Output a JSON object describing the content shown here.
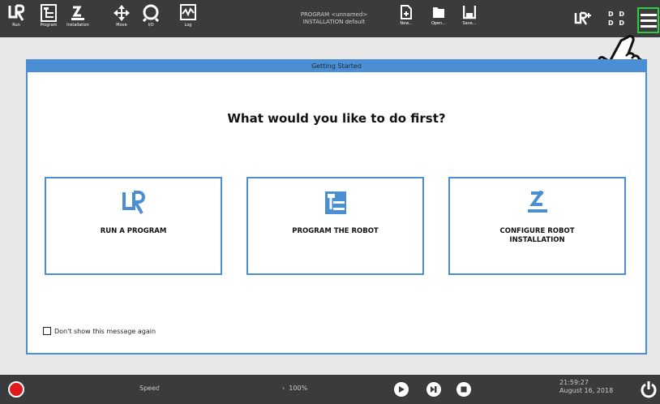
{
  "topbar": {
    "nav": [
      {
        "label": "Run",
        "icon": "ur-logo-icon"
      },
      {
        "label": "Program",
        "icon": "program-icon"
      },
      {
        "label": "Installation",
        "icon": "robot-arm-icon"
      },
      {
        "label": "Move",
        "icon": "move-arrows-icon"
      },
      {
        "label": "I/O",
        "icon": "io-icon"
      },
      {
        "label": "Log",
        "icon": "log-graph-icon"
      }
    ],
    "program_line": "PROGRAM <unnamed>",
    "installation_line": "INSTALLATION default",
    "file": [
      {
        "label": "New...",
        "icon": "new-file-icon"
      },
      {
        "label": "Open...",
        "icon": "open-folder-icon"
      },
      {
        "label": "Save...",
        "icon": "save-icon"
      }
    ],
    "status_dots": [
      "D D",
      "D D"
    ],
    "brand_badge": "UR+"
  },
  "dialog": {
    "title": "Getting Started",
    "question": "What would you like to do first?",
    "options": [
      {
        "label": "RUN A PROGRAM",
        "icon": "ur-logo-icon"
      },
      {
        "label": "PROGRAM THE ROBOT",
        "icon": "program-icon"
      },
      {
        "label": "CONFIGURE ROBOT INSTALLATION",
        "icon": "robot-arm-icon"
      }
    ],
    "dont_show_label": "Don't show this message again"
  },
  "bottombar": {
    "speed_label": "Speed",
    "speed_value": "100%",
    "time": "21:59:27",
    "date": "August 16, 2018"
  },
  "colors": {
    "accent": "#4a8fd4",
    "topbar": "#3b3b3b",
    "highlight": "#2ecc40",
    "stop": "#e21a1a"
  }
}
